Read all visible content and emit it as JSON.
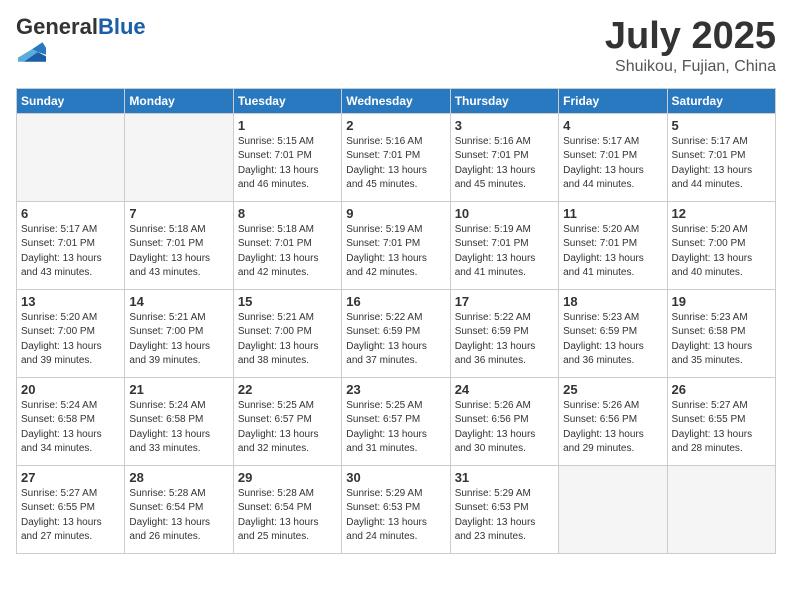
{
  "header": {
    "logo_general": "General",
    "logo_blue": "Blue",
    "title": "July 2025",
    "subtitle": "Shuikou, Fujian, China"
  },
  "days_of_week": [
    "Sunday",
    "Monday",
    "Tuesday",
    "Wednesday",
    "Thursday",
    "Friday",
    "Saturday"
  ],
  "weeks": [
    [
      {
        "day": "",
        "info": ""
      },
      {
        "day": "",
        "info": ""
      },
      {
        "day": "1",
        "info": "Sunrise: 5:15 AM\nSunset: 7:01 PM\nDaylight: 13 hours\nand 46 minutes."
      },
      {
        "day": "2",
        "info": "Sunrise: 5:16 AM\nSunset: 7:01 PM\nDaylight: 13 hours\nand 45 minutes."
      },
      {
        "day": "3",
        "info": "Sunrise: 5:16 AM\nSunset: 7:01 PM\nDaylight: 13 hours\nand 45 minutes."
      },
      {
        "day": "4",
        "info": "Sunrise: 5:17 AM\nSunset: 7:01 PM\nDaylight: 13 hours\nand 44 minutes."
      },
      {
        "day": "5",
        "info": "Sunrise: 5:17 AM\nSunset: 7:01 PM\nDaylight: 13 hours\nand 44 minutes."
      }
    ],
    [
      {
        "day": "6",
        "info": "Sunrise: 5:17 AM\nSunset: 7:01 PM\nDaylight: 13 hours\nand 43 minutes."
      },
      {
        "day": "7",
        "info": "Sunrise: 5:18 AM\nSunset: 7:01 PM\nDaylight: 13 hours\nand 43 minutes."
      },
      {
        "day": "8",
        "info": "Sunrise: 5:18 AM\nSunset: 7:01 PM\nDaylight: 13 hours\nand 42 minutes."
      },
      {
        "day": "9",
        "info": "Sunrise: 5:19 AM\nSunset: 7:01 PM\nDaylight: 13 hours\nand 42 minutes."
      },
      {
        "day": "10",
        "info": "Sunrise: 5:19 AM\nSunset: 7:01 PM\nDaylight: 13 hours\nand 41 minutes."
      },
      {
        "day": "11",
        "info": "Sunrise: 5:20 AM\nSunset: 7:01 PM\nDaylight: 13 hours\nand 41 minutes."
      },
      {
        "day": "12",
        "info": "Sunrise: 5:20 AM\nSunset: 7:00 PM\nDaylight: 13 hours\nand 40 minutes."
      }
    ],
    [
      {
        "day": "13",
        "info": "Sunrise: 5:20 AM\nSunset: 7:00 PM\nDaylight: 13 hours\nand 39 minutes."
      },
      {
        "day": "14",
        "info": "Sunrise: 5:21 AM\nSunset: 7:00 PM\nDaylight: 13 hours\nand 39 minutes."
      },
      {
        "day": "15",
        "info": "Sunrise: 5:21 AM\nSunset: 7:00 PM\nDaylight: 13 hours\nand 38 minutes."
      },
      {
        "day": "16",
        "info": "Sunrise: 5:22 AM\nSunset: 6:59 PM\nDaylight: 13 hours\nand 37 minutes."
      },
      {
        "day": "17",
        "info": "Sunrise: 5:22 AM\nSunset: 6:59 PM\nDaylight: 13 hours\nand 36 minutes."
      },
      {
        "day": "18",
        "info": "Sunrise: 5:23 AM\nSunset: 6:59 PM\nDaylight: 13 hours\nand 36 minutes."
      },
      {
        "day": "19",
        "info": "Sunrise: 5:23 AM\nSunset: 6:58 PM\nDaylight: 13 hours\nand 35 minutes."
      }
    ],
    [
      {
        "day": "20",
        "info": "Sunrise: 5:24 AM\nSunset: 6:58 PM\nDaylight: 13 hours\nand 34 minutes."
      },
      {
        "day": "21",
        "info": "Sunrise: 5:24 AM\nSunset: 6:58 PM\nDaylight: 13 hours\nand 33 minutes."
      },
      {
        "day": "22",
        "info": "Sunrise: 5:25 AM\nSunset: 6:57 PM\nDaylight: 13 hours\nand 32 minutes."
      },
      {
        "day": "23",
        "info": "Sunrise: 5:25 AM\nSunset: 6:57 PM\nDaylight: 13 hours\nand 31 minutes."
      },
      {
        "day": "24",
        "info": "Sunrise: 5:26 AM\nSunset: 6:56 PM\nDaylight: 13 hours\nand 30 minutes."
      },
      {
        "day": "25",
        "info": "Sunrise: 5:26 AM\nSunset: 6:56 PM\nDaylight: 13 hours\nand 29 minutes."
      },
      {
        "day": "26",
        "info": "Sunrise: 5:27 AM\nSunset: 6:55 PM\nDaylight: 13 hours\nand 28 minutes."
      }
    ],
    [
      {
        "day": "27",
        "info": "Sunrise: 5:27 AM\nSunset: 6:55 PM\nDaylight: 13 hours\nand 27 minutes."
      },
      {
        "day": "28",
        "info": "Sunrise: 5:28 AM\nSunset: 6:54 PM\nDaylight: 13 hours\nand 26 minutes."
      },
      {
        "day": "29",
        "info": "Sunrise: 5:28 AM\nSunset: 6:54 PM\nDaylight: 13 hours\nand 25 minutes."
      },
      {
        "day": "30",
        "info": "Sunrise: 5:29 AM\nSunset: 6:53 PM\nDaylight: 13 hours\nand 24 minutes."
      },
      {
        "day": "31",
        "info": "Sunrise: 5:29 AM\nSunset: 6:53 PM\nDaylight: 13 hours\nand 23 minutes."
      },
      {
        "day": "",
        "info": ""
      },
      {
        "day": "",
        "info": ""
      }
    ]
  ]
}
